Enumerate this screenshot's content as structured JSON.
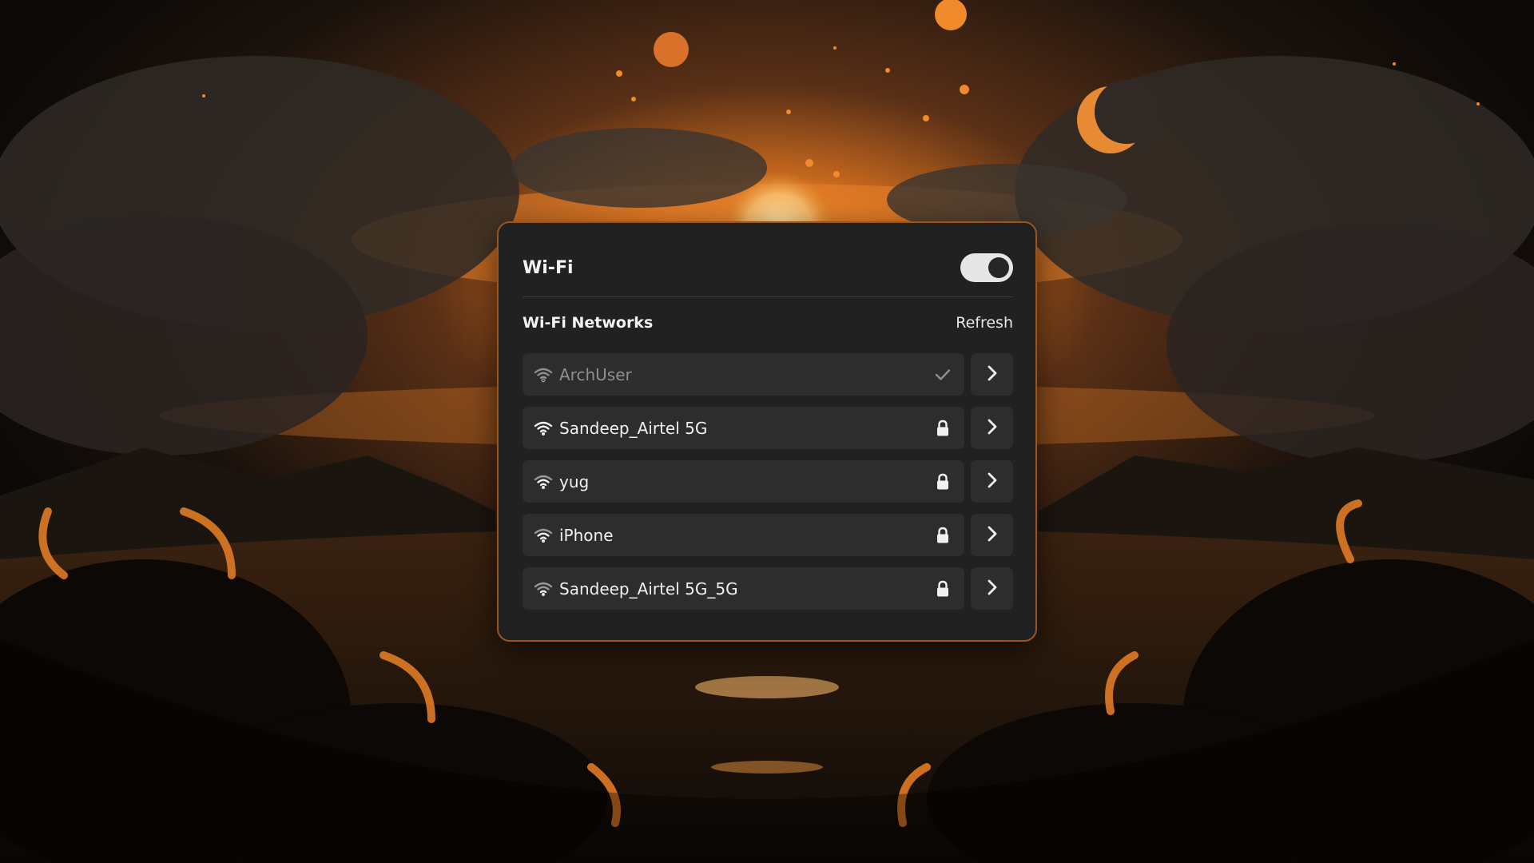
{
  "wallpaper": {
    "description_icon": "sunset-landscape-wallpaper",
    "colors": {
      "sky": "#1a1410",
      "glow": "#f08a2a",
      "sun": "#f5c27a",
      "cloud": "#3a3531"
    }
  },
  "wifi_panel": {
    "title": "Wi-Fi",
    "toggle": {
      "state": "on",
      "icon": "toggle-switch"
    },
    "section_title": "Wi-Fi Networks",
    "refresh_label": "Refresh",
    "networks": [
      {
        "name": "ArchUser",
        "status_icon": "checkmark-icon",
        "connected": true
      },
      {
        "name": "Sandeep_Airtel 5G",
        "status_icon": "lock-icon",
        "connected": false
      },
      {
        "name": "yug",
        "status_icon": "lock-icon",
        "connected": false
      },
      {
        "name": "iPhone",
        "status_icon": "lock-icon",
        "connected": false
      },
      {
        "name": "Sandeep_Airtel 5G_5G",
        "status_icon": "lock-icon",
        "connected": false
      }
    ]
  },
  "colors": {
    "panel_bg": "#212121",
    "panel_border": "#9a5420",
    "row_bg": "#2d2d2d",
    "text": "#f0f0f0",
    "muted_text": "#8f8f8f"
  }
}
